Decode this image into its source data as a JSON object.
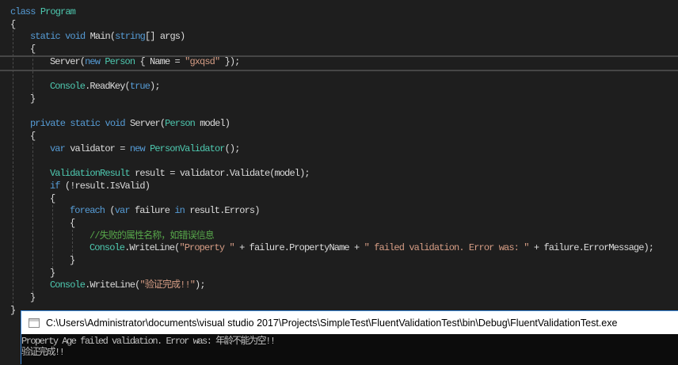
{
  "editor": {
    "colors": {
      "background": "#1e1e1e",
      "keyword": "#569cd6",
      "type": "#4ec9b0",
      "string": "#d69d85",
      "comment": "#57a64a",
      "text": "#dcdcdc"
    },
    "lines": [
      {
        "indent": 0,
        "tokens": [
          [
            "kw",
            "class "
          ],
          [
            "ty",
            "Program"
          ]
        ]
      },
      {
        "indent": 0,
        "tokens": [
          [
            "tx",
            "{"
          ]
        ]
      },
      {
        "indent": 1,
        "tokens": [
          [
            "kw",
            "static void "
          ],
          [
            "tx",
            "Main("
          ],
          [
            "kw",
            "string"
          ],
          [
            "tx",
            "[] args)"
          ]
        ]
      },
      {
        "indent": 1,
        "tokens": [
          [
            "tx",
            "{"
          ]
        ]
      },
      {
        "indent": 2,
        "tokens": [
          [
            "tx",
            "Server("
          ],
          [
            "kw",
            "new "
          ],
          [
            "ty",
            "Person"
          ],
          [
            "tx",
            " { Name = "
          ],
          [
            "st",
            "\"gxqsd\""
          ],
          [
            "tx",
            " });"
          ]
        ]
      },
      {
        "indent": 0,
        "tokens": []
      },
      {
        "indent": 2,
        "tokens": [
          [
            "ty",
            "Console"
          ],
          [
            "tx",
            ".ReadKey("
          ],
          [
            "kw",
            "true"
          ],
          [
            "tx",
            ");"
          ]
        ]
      },
      {
        "indent": 1,
        "tokens": [
          [
            "tx",
            "}"
          ]
        ]
      },
      {
        "indent": 0,
        "tokens": []
      },
      {
        "indent": 1,
        "tokens": [
          [
            "kw",
            "private static void "
          ],
          [
            "tx",
            "Server("
          ],
          [
            "ty",
            "Person"
          ],
          [
            "tx",
            " model)"
          ]
        ]
      },
      {
        "indent": 1,
        "tokens": [
          [
            "tx",
            "{"
          ]
        ]
      },
      {
        "indent": 2,
        "tokens": [
          [
            "kw",
            "var "
          ],
          [
            "tx",
            "validator = "
          ],
          [
            "kw",
            "new "
          ],
          [
            "ty",
            "PersonValidator"
          ],
          [
            "tx",
            "();"
          ]
        ]
      },
      {
        "indent": 0,
        "tokens": []
      },
      {
        "indent": 2,
        "tokens": [
          [
            "ty",
            "ValidationResult"
          ],
          [
            "tx",
            " result = validator.Validate(model);"
          ]
        ]
      },
      {
        "indent": 2,
        "tokens": [
          [
            "kw",
            "if "
          ],
          [
            "tx",
            "(!result.IsValid)"
          ]
        ]
      },
      {
        "indent": 2,
        "tokens": [
          [
            "tx",
            "{"
          ]
        ]
      },
      {
        "indent": 3,
        "tokens": [
          [
            "kw",
            "foreach "
          ],
          [
            "tx",
            "("
          ],
          [
            "kw",
            "var "
          ],
          [
            "tx",
            "failure "
          ],
          [
            "kw",
            "in "
          ],
          [
            "tx",
            "result.Errors)"
          ]
        ]
      },
      {
        "indent": 3,
        "tokens": [
          [
            "tx",
            "{"
          ]
        ]
      },
      {
        "indent": 4,
        "tokens": [
          [
            "cm",
            "//失败的属性名称，如错误信息"
          ]
        ]
      },
      {
        "indent": 4,
        "tokens": [
          [
            "ty",
            "Console"
          ],
          [
            "tx",
            ".WriteLine("
          ],
          [
            "st",
            "\"Property \""
          ],
          [
            "tx",
            " + failure.PropertyName + "
          ],
          [
            "st",
            "\" failed validation. Error was: \""
          ],
          [
            "tx",
            " + failure.ErrorMessage);"
          ]
        ]
      },
      {
        "indent": 3,
        "tokens": [
          [
            "tx",
            "}"
          ]
        ]
      },
      {
        "indent": 2,
        "tokens": [
          [
            "tx",
            "}"
          ]
        ]
      },
      {
        "indent": 2,
        "tokens": [
          [
            "ty",
            "Console"
          ],
          [
            "tx",
            ".WriteLine("
          ],
          [
            "st",
            "\"验证完成!!\""
          ],
          [
            "tx",
            ");"
          ]
        ]
      },
      {
        "indent": 1,
        "tokens": [
          [
            "tx",
            "}"
          ]
        ]
      },
      {
        "indent": 0,
        "tokens": [
          [
            "tx",
            "}"
          ]
        ]
      }
    ]
  },
  "console": {
    "title": "C:\\Users\\Administrator\\documents\\visual studio 2017\\Projects\\SimpleTest\\FluentValidationTest\\bin\\Debug\\FluentValidationTest.exe",
    "output": [
      "Property Age failed validation. Error was: 年龄不能为空!!",
      "验证完成!!"
    ]
  }
}
